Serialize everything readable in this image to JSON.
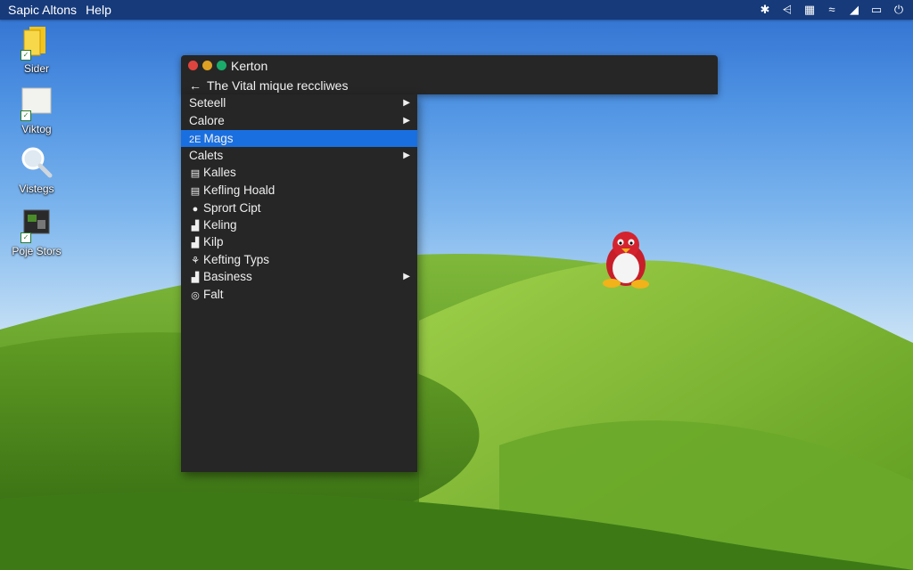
{
  "topbar": {
    "menu": [
      "Sapic Altons",
      "Help"
    ],
    "tray_icons": [
      "gear-icon",
      "share-icon",
      "calendar-icon",
      "sound-icon",
      "network-icon",
      "window-icon",
      "power-icon"
    ]
  },
  "desktop_icons": [
    {
      "label": "Sider",
      "icon": "folder-icon"
    },
    {
      "label": "Viktog",
      "icon": "document-icon"
    },
    {
      "label": "Vistegs",
      "icon": "magnifier-icon"
    },
    {
      "label": "Poje Stors",
      "icon": "photo-icon"
    }
  ],
  "window": {
    "title": "Kerton",
    "nav_text": "The Vital mique reccliwes",
    "colors": {
      "close": "#e0443e",
      "minimize": "#dea123",
      "maximize": "#1aab6b"
    }
  },
  "menu": {
    "items": [
      {
        "label": "Seteell",
        "icon": "",
        "submenu": true,
        "active": false
      },
      {
        "label": "Calore",
        "icon": "",
        "submenu": true,
        "active": false
      },
      {
        "label": "Mags",
        "icon": "2E",
        "submenu": false,
        "active": true
      },
      {
        "label": "Calets",
        "icon": "",
        "submenu": true,
        "active": false
      },
      {
        "label": "Kalles",
        "icon": "▤",
        "submenu": false,
        "active": false
      },
      {
        "label": "Kefling Hoald",
        "icon": "▤",
        "submenu": false,
        "active": false
      },
      {
        "label": "Sprort Cipt",
        "icon": "●",
        "submenu": false,
        "active": false
      },
      {
        "label": "Keling",
        "icon": "▟",
        "submenu": false,
        "active": false
      },
      {
        "label": "Kilp",
        "icon": "▟",
        "submenu": false,
        "active": false
      },
      {
        "label": "Kefting Typs",
        "icon": "⚘",
        "submenu": false,
        "active": false
      },
      {
        "label": "Basiness",
        "icon": "▟",
        "submenu": true,
        "active": false
      },
      {
        "label": "Falt",
        "icon": "◎",
        "submenu": false,
        "active": false
      }
    ],
    "accent": "#1a6fe0"
  }
}
